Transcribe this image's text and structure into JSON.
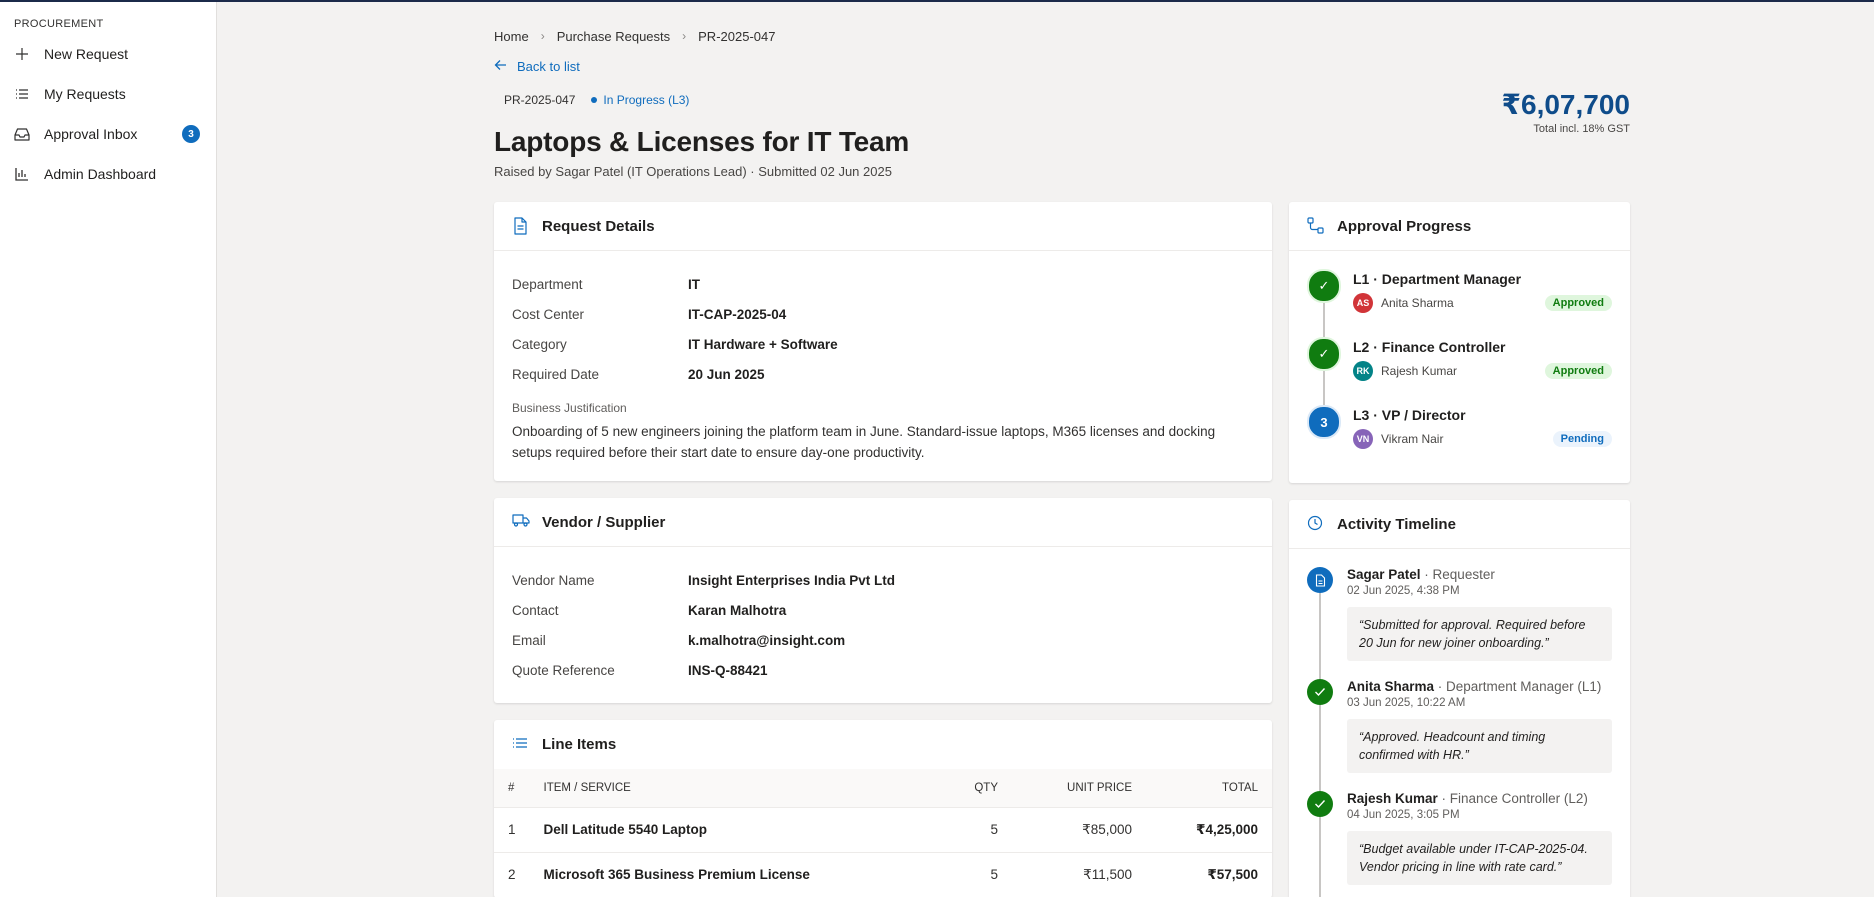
{
  "sidebar": {
    "section": "PROCUREMENT",
    "items": [
      {
        "label": "New Request",
        "icon": "plus-icon"
      },
      {
        "label": "My Requests",
        "icon": "list-icon"
      },
      {
        "label": "Approval Inbox",
        "icon": "inbox-icon",
        "badge": "3"
      },
      {
        "label": "Admin Dashboard",
        "icon": "bar-chart-icon"
      }
    ]
  },
  "breadcrumb": [
    "Home",
    "Purchase Requests",
    "PR-2025-047"
  ],
  "back_label": "Back to list",
  "request": {
    "id": "PR-2025-047",
    "status": "In Progress (L3)",
    "title": "Laptops & Licenses for IT Team",
    "subtitle": "Raised by Sagar Patel (IT Operations Lead) · Submitted 02 Jun 2025",
    "total": "₹6,07,700",
    "total_note": "Total incl. 18% GST"
  },
  "details": {
    "title": "Request Details",
    "rows": [
      {
        "key": "Department",
        "value": "IT"
      },
      {
        "key": "Cost Center",
        "value": "IT-CAP-2025-04"
      },
      {
        "key": "Category",
        "value": "IT Hardware + Software"
      },
      {
        "key": "Required Date",
        "value": "20 Jun 2025"
      }
    ],
    "justification_label": "Business Justification",
    "justification": "Onboarding of 5 new engineers joining the platform team in June. Standard-issue laptops, M365 licenses and docking setups required before their start date to ensure day-one productivity."
  },
  "vendor": {
    "title": "Vendor / Supplier",
    "rows": [
      {
        "key": "Vendor Name",
        "value": "Insight Enterprises India Pvt Ltd"
      },
      {
        "key": "Contact",
        "value": "Karan Malhotra"
      },
      {
        "key": "Email",
        "value": "k.malhotra@insight.com"
      },
      {
        "key": "Quote Reference",
        "value": "INS-Q-88421"
      }
    ]
  },
  "line_items": {
    "title": "Line Items",
    "columns": [
      "#",
      "ITEM / SERVICE",
      "QTY",
      "UNIT PRICE",
      "TOTAL"
    ],
    "rows": [
      {
        "n": "1",
        "item": "Dell Latitude 5540 Laptop",
        "qty": "5",
        "unit": "₹85,000",
        "total": "₹4,25,000"
      },
      {
        "n": "2",
        "item": "Microsoft 365 Business Premium License",
        "qty": "5",
        "unit": "₹11,500",
        "total": "₹57,500"
      }
    ]
  },
  "approval": {
    "title": "Approval Progress",
    "steps": [
      {
        "marker": "✓",
        "title": "L1 · Department Manager",
        "initials": "AS",
        "name": "Anita Sharma",
        "status": "Approved",
        "avatar_color": "#d13438",
        "state": "approved"
      },
      {
        "marker": "✓",
        "title": "L2 · Finance Controller",
        "initials": "RK",
        "name": "Rajesh Kumar",
        "status": "Approved",
        "avatar_color": "#038387",
        "state": "approved"
      },
      {
        "marker": "3",
        "title": "L3 · VP / Director",
        "initials": "VN",
        "name": "Vikram Nair",
        "status": "Pending",
        "avatar_color": "#8764b8",
        "state": "pending"
      }
    ]
  },
  "activity": {
    "title": "Activity Timeline",
    "items": [
      {
        "who": "Sagar Patel",
        "role": " · Requester",
        "time": "02 Jun 2025, 4:38 PM",
        "quote": "“Submitted for approval. Required before 20 Jun for new joiner onboarding.”",
        "icon": "document-icon",
        "color": "blue"
      },
      {
        "who": "Anita Sharma",
        "role": " · Department Manager (L1)",
        "time": "03 Jun 2025, 10:22 AM",
        "quote": "“Approved. Headcount and timing confirmed with HR.”",
        "icon": "check-icon",
        "color": "green"
      },
      {
        "who": "Rajesh Kumar",
        "role": " · Finance Controller (L2)",
        "time": "04 Jun 2025, 3:05 PM",
        "quote": "“Budget available under IT-CAP-2025-04. Vendor pricing in line with rate card.”",
        "icon": "check-icon",
        "color": "green"
      }
    ]
  },
  "colors": {
    "accent": "#0f6cbd",
    "approved": "#107c10",
    "page_bg": "#f3f2f1",
    "total": "#0f4c8a"
  }
}
